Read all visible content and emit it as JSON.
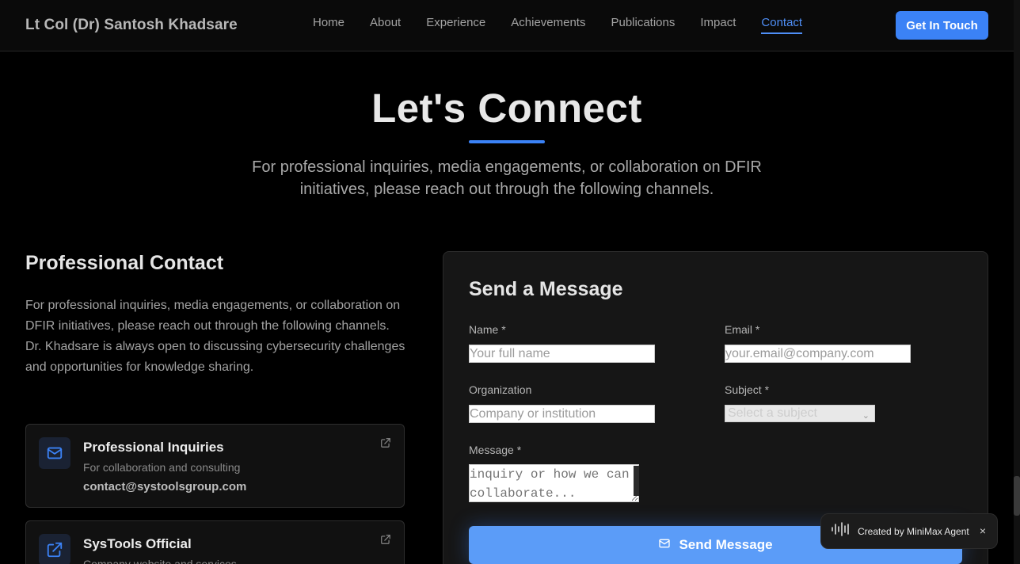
{
  "header": {
    "brand": "Lt Col (Dr) Santosh Khadsare",
    "nav": [
      "Home",
      "About",
      "Experience",
      "Achievements",
      "Publications",
      "Impact",
      "Contact"
    ],
    "active_nav": "Contact",
    "cta_label": "Get In Touch"
  },
  "hero": {
    "title": "Let's Connect",
    "subtitle": "For professional inquiries, media engagements, or collaboration on DFIR initiatives, please reach out through the following channels."
  },
  "contact": {
    "title": "Professional Contact",
    "description": "For professional inquiries, media engagements, or collaboration on DFIR initiatives, please reach out through the following channels. Dr. Khadsare is always open to discussing cybersecurity challenges and opportunities for knowledge sharing.",
    "cards": [
      {
        "title": "Professional Inquiries",
        "subtitle": "For collaboration and consulting",
        "value": "contact@systoolsgroup.com",
        "icon": "mail-icon"
      },
      {
        "title": "SysTools Official",
        "subtitle": "Company website and services",
        "value": "",
        "icon": "external-link-icon"
      }
    ]
  },
  "form": {
    "title": "Send a Message",
    "name_label": "Name *",
    "name_placeholder": "Your full name",
    "email_label": "Email *",
    "email_placeholder": "your.email@company.com",
    "org_label": "Organization",
    "org_placeholder": "Company or institution",
    "subject_label": "Subject *",
    "subject_value": "Select a subject",
    "message_label": "Message *",
    "message_placeholder": "inquiry or how we can collaborate...",
    "send_label": "Send Message"
  },
  "badge": {
    "text": "Created by MiniMax Agent",
    "close": "×"
  },
  "colors": {
    "accent": "#3b82f6",
    "background": "#000000",
    "card": "#111111"
  }
}
